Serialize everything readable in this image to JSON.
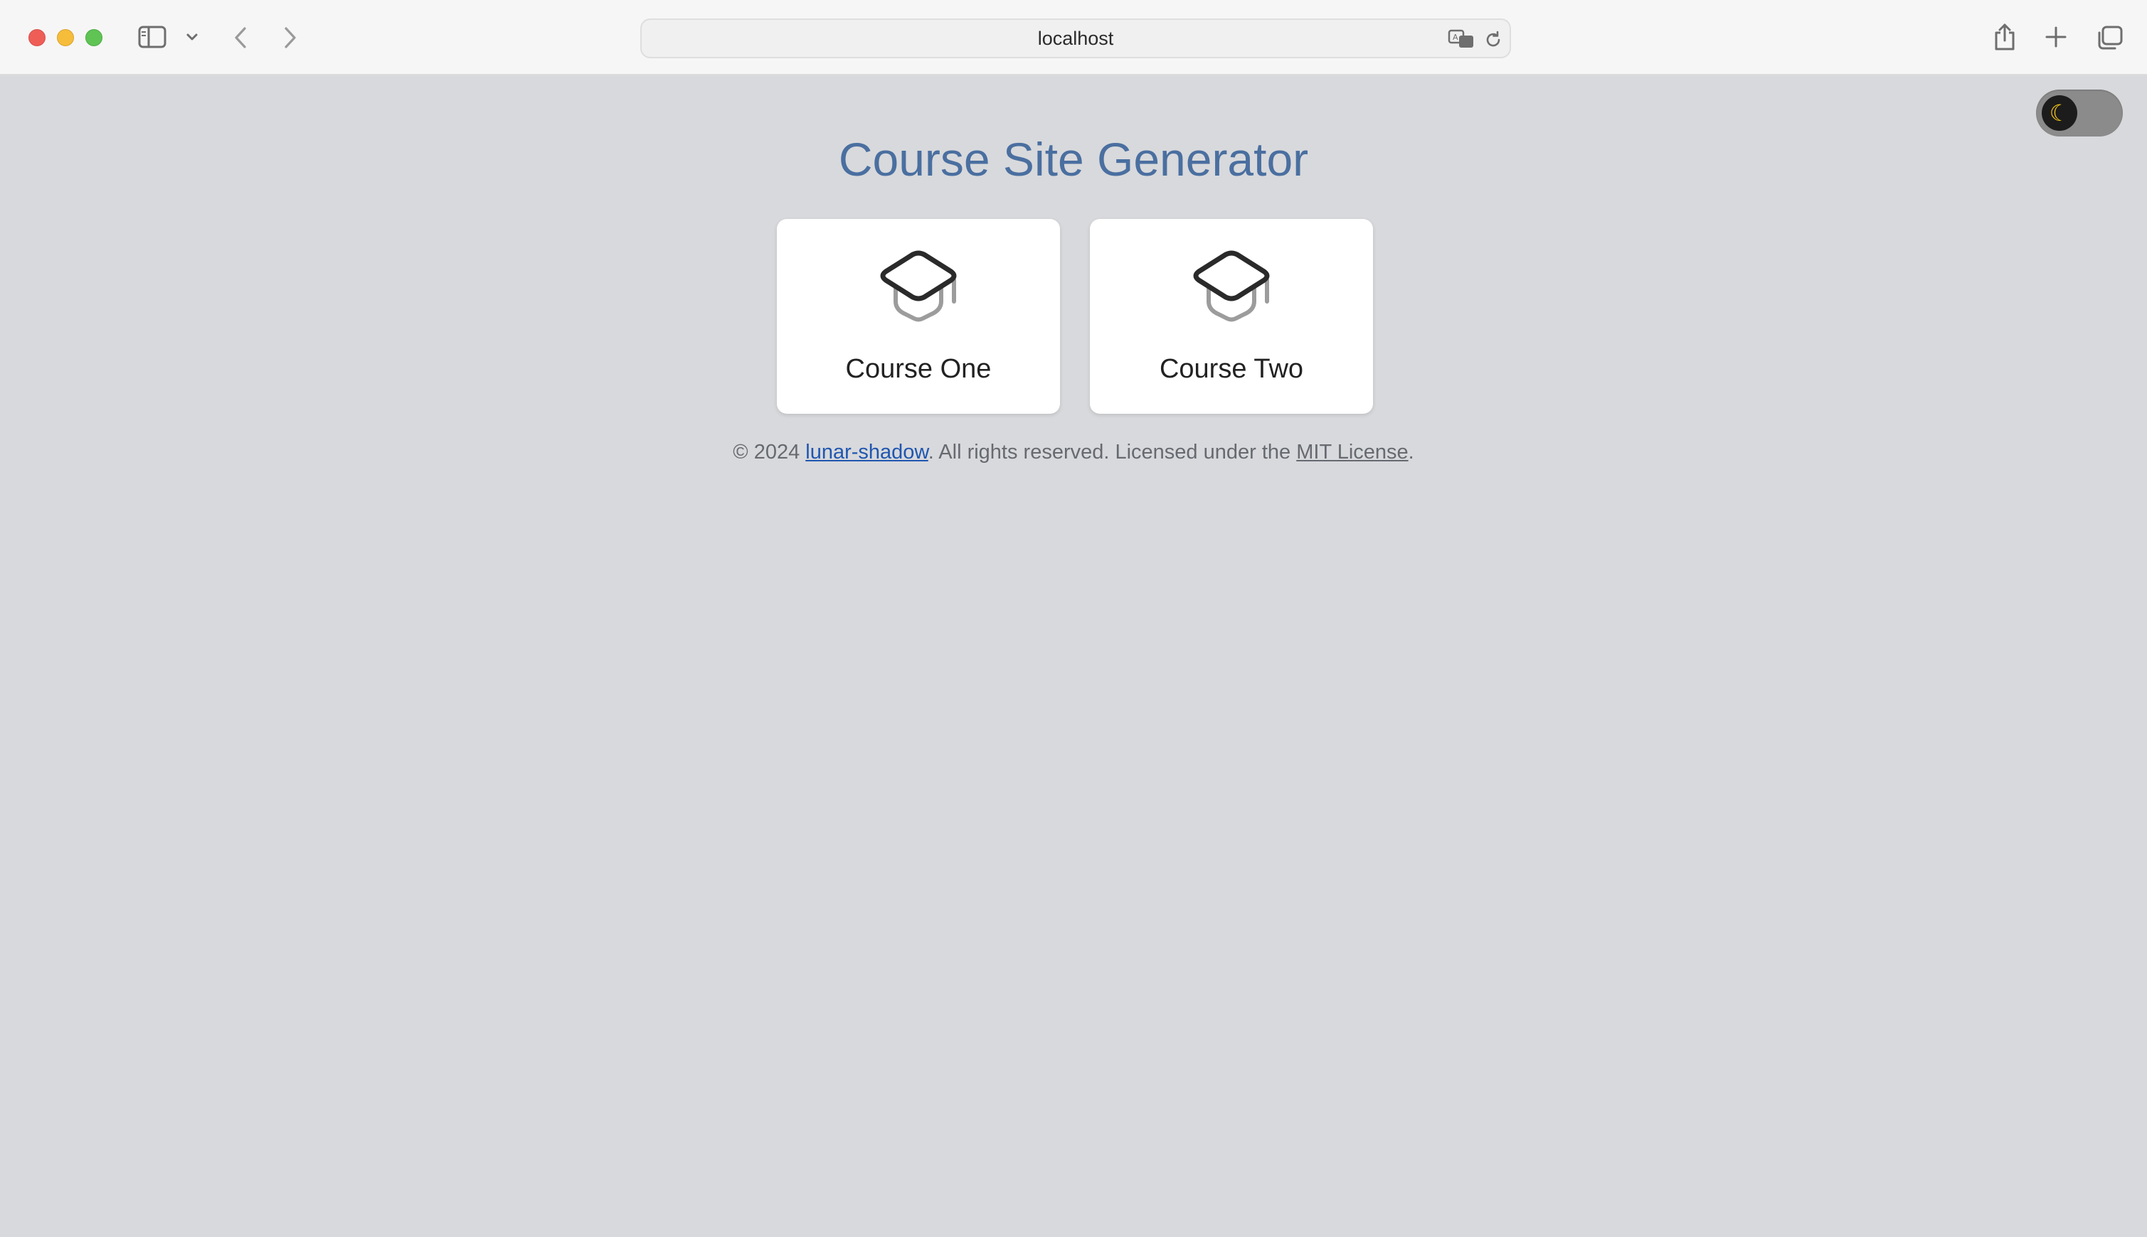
{
  "browser": {
    "url": "localhost",
    "icons": {
      "close": "close-icon",
      "minimize": "minimize-icon",
      "zoom": "zoom-icon",
      "sidebar": "sidebar-icon",
      "dropdown": "chevron-down-icon",
      "back": "back-icon",
      "forward": "forward-icon",
      "translate": "translate-icon",
      "reload": "reload-icon",
      "share": "share-icon",
      "new_tab": "plus-icon",
      "tabs": "tab-overview-icon"
    }
  },
  "page": {
    "title": "Course Site Generator",
    "theme_toggle": {
      "icon": "moon-icon",
      "glyph": "☾",
      "mode": "light"
    },
    "courses": [
      {
        "label": "Course One",
        "icon": "graduation-cap-icon"
      },
      {
        "label": "Course Two",
        "icon": "graduation-cap-icon"
      }
    ],
    "footer": {
      "prefix": "© 2024 ",
      "author": "lunar-shadow",
      "middle": ". All rights reserved. Licensed under the ",
      "license": "MIT License",
      "suffix": "."
    }
  },
  "colors": {
    "page_background": "#d8d9dc",
    "title": "#4a6fa0",
    "author_link": "#1f56b0",
    "card_background": "#ffffff",
    "toggle_track": "#8b8b8b",
    "toggle_knob": "#1c1c1c",
    "moon": "#f5c518"
  }
}
